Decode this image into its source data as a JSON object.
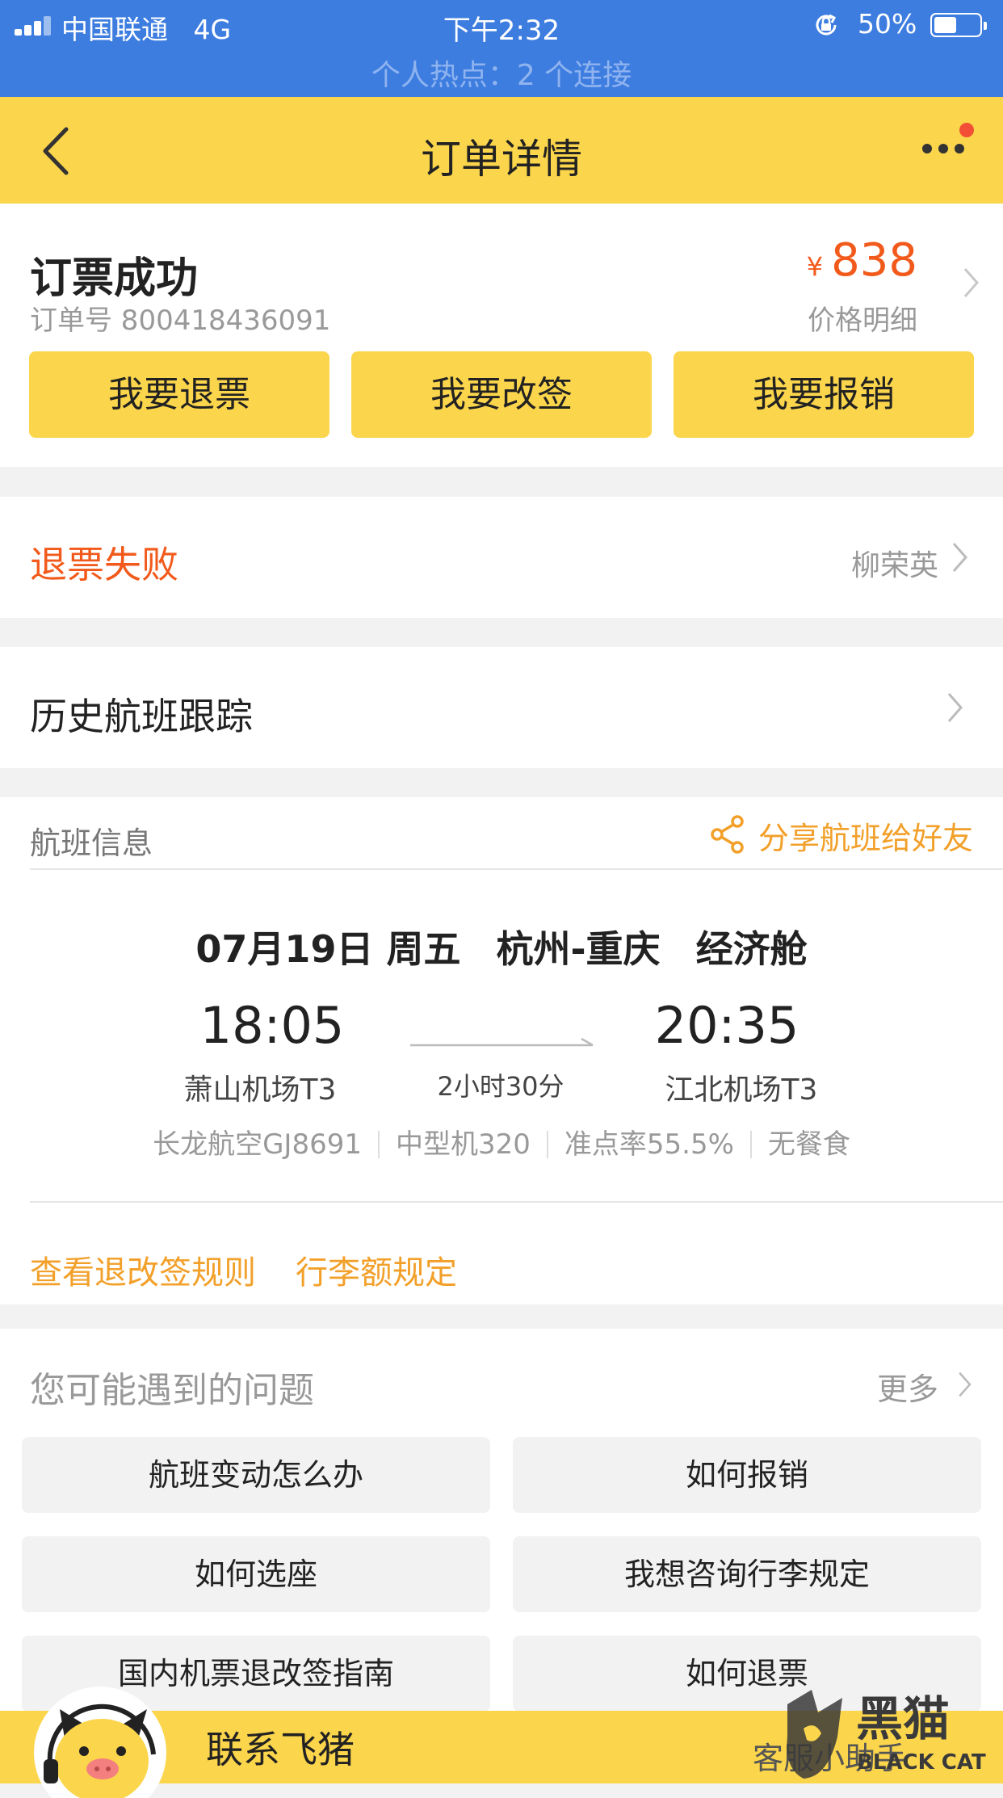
{
  "status_bar": {
    "carrier": "中国联通",
    "network": "4G",
    "time": "下午2:32",
    "battery_pct": "50%",
    "battery_level": 0.5,
    "hotspot": "个人热点：2 个连接"
  },
  "navbar": {
    "title": "订单详情",
    "icons": [
      "back-icon",
      "more-icon",
      "notification-dot"
    ]
  },
  "order": {
    "status": "订票成功",
    "order_number": "订单号 800418436091",
    "currency": "¥",
    "price": "838",
    "price_detail": "价格明细",
    "actions": [
      "我要退票",
      "我要改签",
      "我要报销"
    ]
  },
  "refund": {
    "status": "退票失败",
    "passenger": "柳荣英"
  },
  "history": {
    "label": "历史航班跟踪"
  },
  "flight": {
    "section_title": "航班信息",
    "share_label": "分享航班给好友",
    "date": "07月19日 周五",
    "route": "杭州-重庆",
    "cabin": "经济舱",
    "depart_time": "18:05",
    "depart_airport": "萧山机场T3",
    "duration": "2小时30分",
    "arrive_time": "20:35",
    "arrive_airport": "江北机场T3",
    "meta": [
      "长龙航空GJ8691",
      "中型机320",
      "准点率55.5%",
      "无餐食"
    ],
    "links": [
      "查看退改签规则",
      "行李额规定"
    ]
  },
  "questions": {
    "title": "您可能遇到的问题",
    "more": "更多",
    "items": [
      "航班变动怎么办",
      "如何报销",
      "如何选座",
      "我想咨询行李规定",
      "国内机票退改签指南",
      "如何退票"
    ]
  },
  "contact": {
    "label": "联系飞猪",
    "right": "客服小助手"
  },
  "watermark": {
    "text": "黑猫",
    "subtext": "BLACK CAT"
  },
  "colors": {
    "status_bar": "#3d7de0",
    "brand_yellow": "#fbd54b",
    "price_orange": "#f25a1b",
    "link_orange": "#f2a02a"
  }
}
